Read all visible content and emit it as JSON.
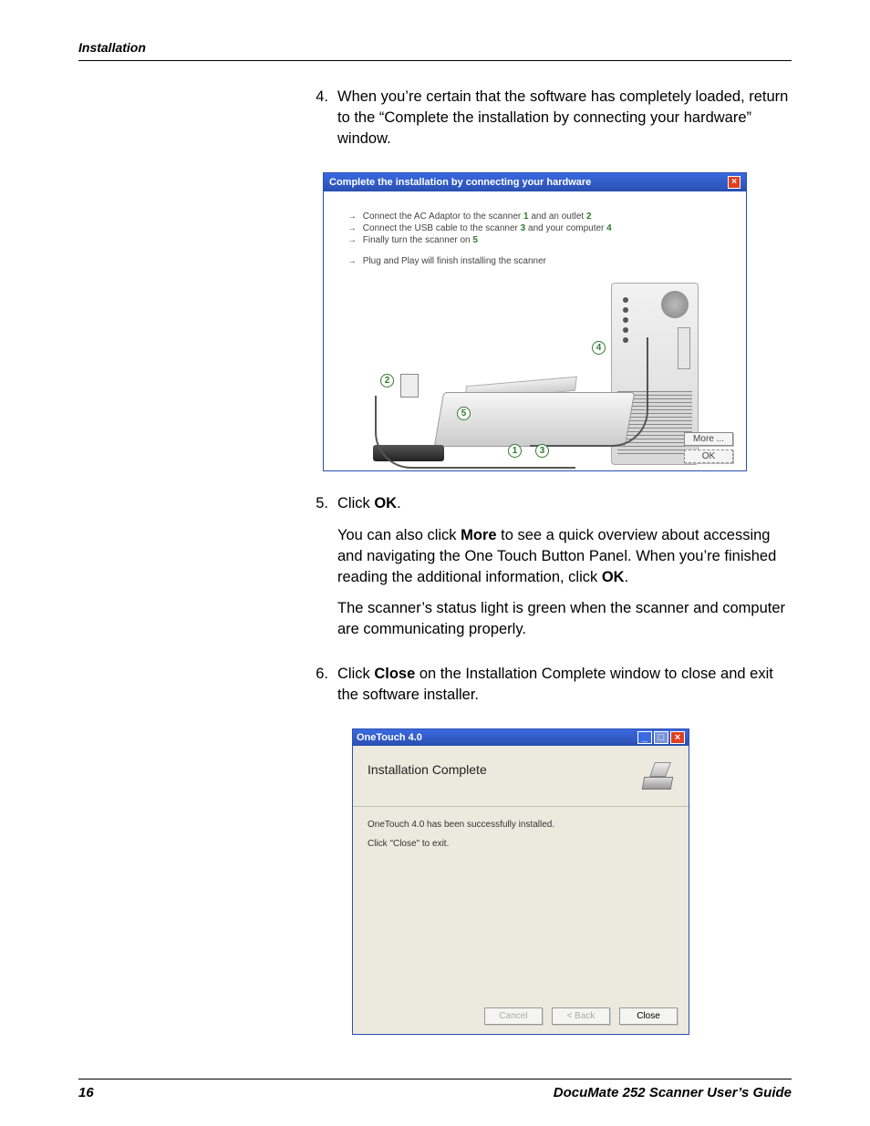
{
  "header": {
    "section": "Installation"
  },
  "steps": {
    "s4": {
      "num": "4.",
      "text": "When you’re certain that the software has completely loaded, return to the “Complete the installation by connecting your hardware” window."
    },
    "s5": {
      "num": "5.",
      "line1_a": "Click ",
      "line1_b": "OK",
      "line1_c": ".",
      "line2_a": "You can also click ",
      "line2_b": "More",
      "line2_c": " to see a quick overview about accessing and navigating the One Touch Button Panel. When you’re finished reading the additional information, click ",
      "line2_d": "OK",
      "line2_e": ".",
      "line3": "The scanner’s status light is green when the scanner and computer are communicating properly."
    },
    "s6": {
      "num": "6.",
      "a": "Click ",
      "b": "Close",
      "c": " on the Installation Complete window to close and exit the software installer."
    }
  },
  "win1": {
    "title": "Complete the installation by connecting your hardware",
    "close_glyph": "×",
    "l1a": "Connect the AC Adaptor to the scanner ",
    "l1n1": "1",
    "l1b": " and an outlet ",
    "l1n2": "2",
    "l2a": "Connect the USB cable to the scanner ",
    "l2n1": "3",
    "l2b": " and your computer ",
    "l2n2": "4",
    "l3a": "Finally turn the scanner on ",
    "l3n1": "5",
    "l4": "Plug and Play will finish installing the scanner",
    "more": "More ...",
    "ok": "OK",
    "circles": {
      "c1": "1",
      "c2": "2",
      "c3": "3",
      "c4": "4",
      "c5": "5"
    }
  },
  "win2": {
    "title": "OneTouch 4.0",
    "min": "_",
    "max": "□",
    "x": "×",
    "heading": "Installation Complete",
    "body1": "OneTouch 4.0 has been successfully installed.",
    "body2": "Click \"Close\" to exit.",
    "cancel": "Cancel",
    "back": "< Back",
    "close": "Close"
  },
  "footer": {
    "page": "16",
    "doc": "DocuMate 252 Scanner User’s Guide"
  }
}
